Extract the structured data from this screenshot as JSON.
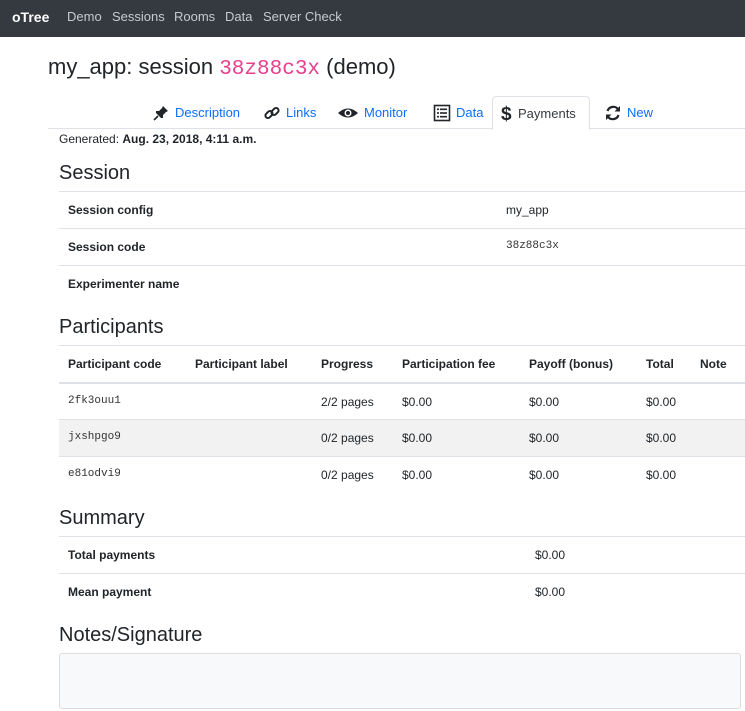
{
  "navbar": {
    "brand": "oTree",
    "links": [
      "Demo",
      "Sessions",
      "Rooms",
      "Data",
      "Server Check"
    ]
  },
  "title": {
    "prefix": "my_app: session ",
    "code": "38z88c3x",
    "suffix": " (demo)"
  },
  "tabs": [
    {
      "label": "Description",
      "icon": "pushpin-icon"
    },
    {
      "label": "Links",
      "icon": "link-icon"
    },
    {
      "label": "Monitor",
      "icon": "eye-icon"
    },
    {
      "label": "Data",
      "icon": "list-icon"
    },
    {
      "label": "Payments",
      "icon": "dollar-icon",
      "active": true
    },
    {
      "label": "New",
      "icon": "refresh-icon"
    }
  ],
  "generated": {
    "label": "Generated: ",
    "value": "Aug. 23, 2018, 4:11 a.m."
  },
  "session": {
    "heading": "Session",
    "rows": [
      {
        "label": "Session config",
        "value": "my_app"
      },
      {
        "label": "Session code",
        "value": "38z88c3x"
      },
      {
        "label": "Experimenter name",
        "value": ""
      }
    ]
  },
  "participants": {
    "heading": "Participants",
    "columns": [
      "Participant code",
      "Participant label",
      "Progress",
      "Participation fee",
      "Payoff (bonus)",
      "Total",
      "Note"
    ],
    "rows": [
      {
        "code": "2fk3ouu1",
        "label": "",
        "progress": "2/2 pages",
        "fee": "$0.00",
        "payoff": "$0.00",
        "total": "$0.00",
        "note": ""
      },
      {
        "code": "jxshpgo9",
        "label": "",
        "progress": "0/2 pages",
        "fee": "$0.00",
        "payoff": "$0.00",
        "total": "$0.00",
        "note": ""
      },
      {
        "code": "e81odvi9",
        "label": "",
        "progress": "0/2 pages",
        "fee": "$0.00",
        "payoff": "$0.00",
        "total": "$0.00",
        "note": ""
      }
    ]
  },
  "summary": {
    "heading": "Summary",
    "rows": [
      {
        "label": "Total payments",
        "value": "$0.00"
      },
      {
        "label": "Mean payment",
        "value": "$0.00"
      }
    ]
  },
  "notes": {
    "heading": "Notes/Signature"
  },
  "colors": {
    "navbar": "#343a40",
    "link": "#0d6efd",
    "code": "#e83e8c"
  }
}
